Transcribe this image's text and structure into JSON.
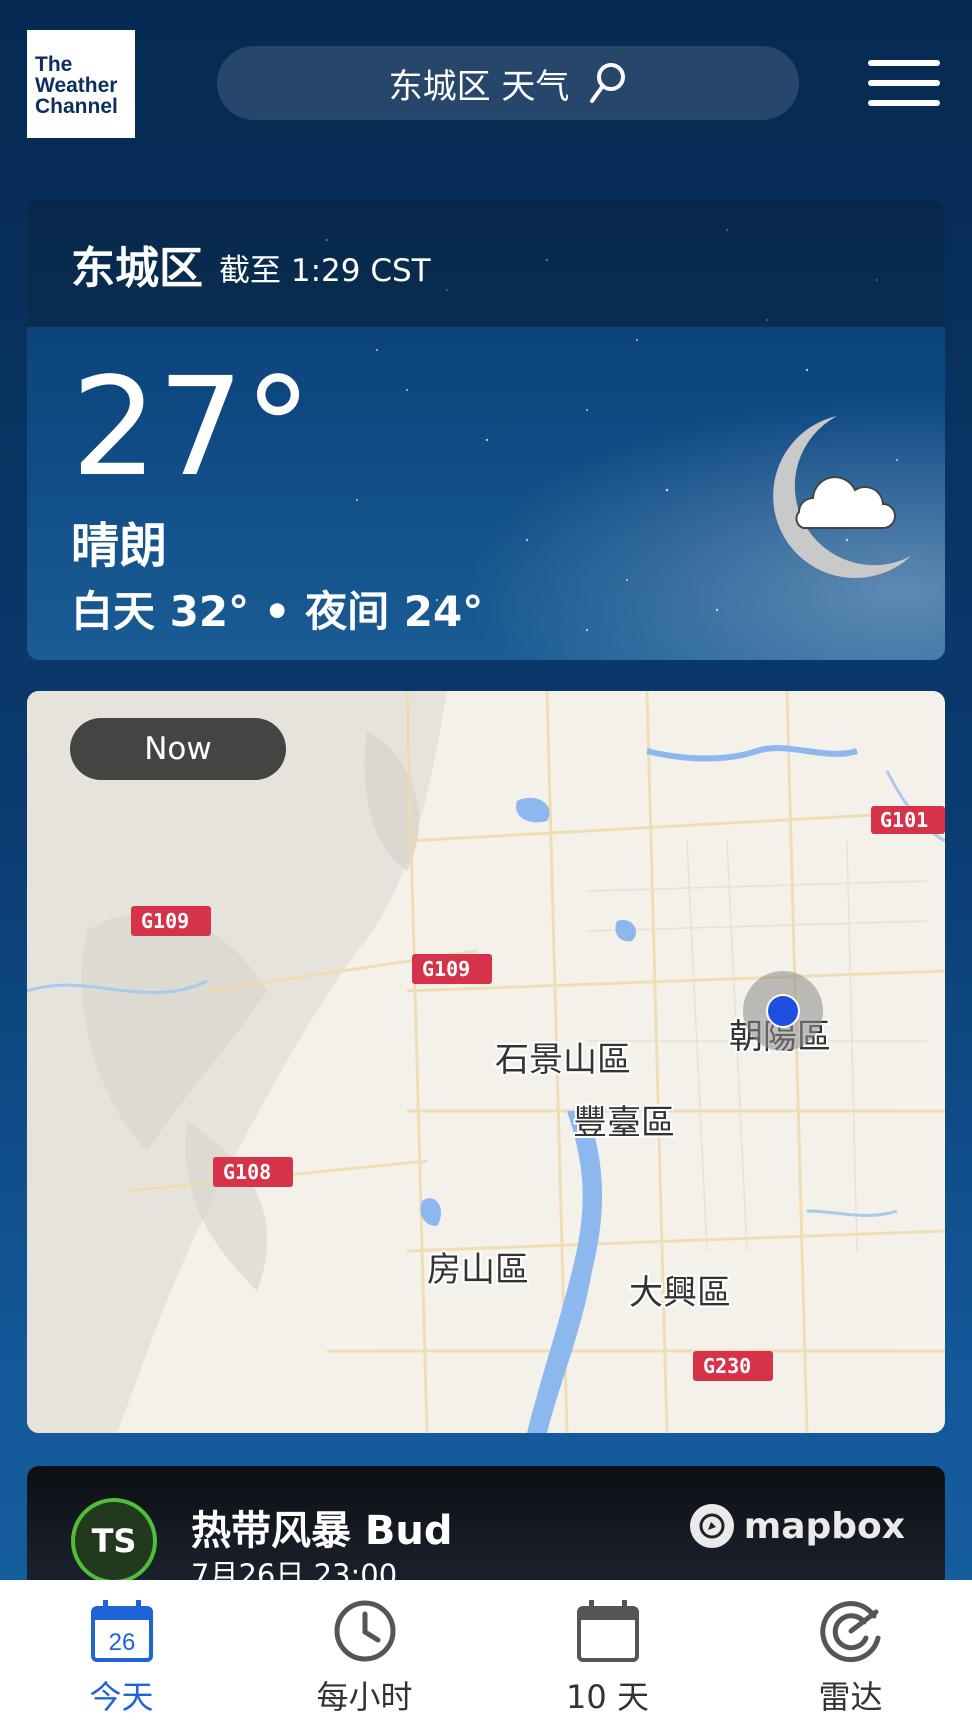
{
  "header": {
    "logo_lines": [
      "The",
      "Weather",
      "Channel"
    ],
    "search_label": "东城区 天气"
  },
  "current": {
    "city": "东城区",
    "as_of": "截至 1:29 CST",
    "temperature": "27°",
    "condition": "晴朗",
    "hi_lo": "白天 32° • 夜间 24°",
    "icon": "moon-cloud-icon"
  },
  "map": {
    "time_label": "Now",
    "road_labels": [
      "G101",
      "G109",
      "G109",
      "G108",
      "G230"
    ],
    "district_labels": [
      "朝陽區",
      "石景山區",
      "豐臺區",
      "房山區",
      "大興區"
    ]
  },
  "storm": {
    "badge": "TS",
    "name": "热带风暴 Bud",
    "time": "7月26日 23:00",
    "attribution": "mapbox"
  },
  "tabs": [
    {
      "label": "今天",
      "icon": "calendar-day-icon",
      "day": "26",
      "active": true
    },
    {
      "label": "每小时",
      "icon": "clock-icon",
      "active": false
    },
    {
      "label": "10 天",
      "icon": "calendar-icon",
      "active": false
    },
    {
      "label": "雷达",
      "icon": "radar-icon",
      "active": false
    }
  ],
  "colors": {
    "active_tab": "#1e64d6",
    "location_dot": "#1e4fe0",
    "storm_ring": "#4fbf3a"
  }
}
